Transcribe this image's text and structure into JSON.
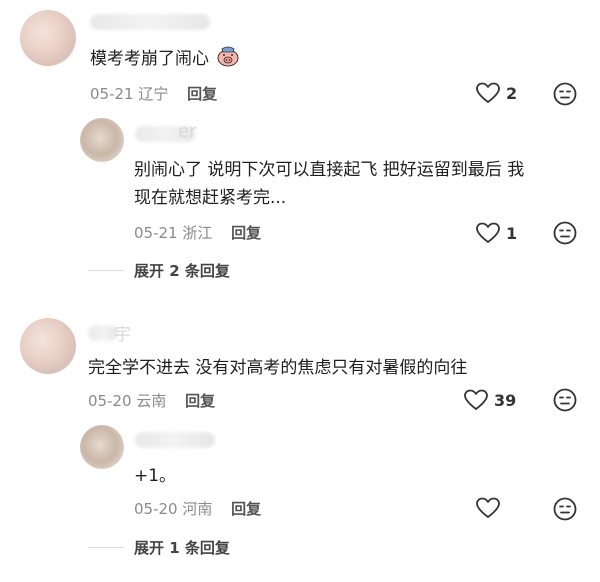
{
  "comments": [
    {
      "text": "模考考崩了闹心",
      "date": "05-21",
      "location": "辽宁",
      "reply_label": "回复",
      "likes": "2"
    },
    {
      "text_line1": "别闹心了 说明下次可以直接起飞 把好运留到最后 我",
      "text_line2": "现在就想赶紧考完...",
      "name_fragment": "er",
      "date": "05-21",
      "location": "浙江",
      "reply_label": "回复",
      "likes": "1",
      "expand_label": "展开 2 条回复"
    },
    {
      "text": "完全学不进去 没有对高考的焦虑只有对暑假的向往",
      "name_fragment": "宇",
      "date": "05-20",
      "location": "云南",
      "reply_label": "回复",
      "likes": "39"
    },
    {
      "text": "+1。",
      "date": "05-20",
      "location": "河南",
      "reply_label": "回复",
      "likes": "",
      "expand_label": "展开 1 条回复"
    }
  ],
  "icons": {
    "like": "heart-outline-icon",
    "dislike": "meh-face-icon",
    "emoji": "pig-face-emoji"
  },
  "colors": {
    "meta": "#8a8a8a",
    "text": "#1f1f1f",
    "divider": "#dddddd"
  }
}
